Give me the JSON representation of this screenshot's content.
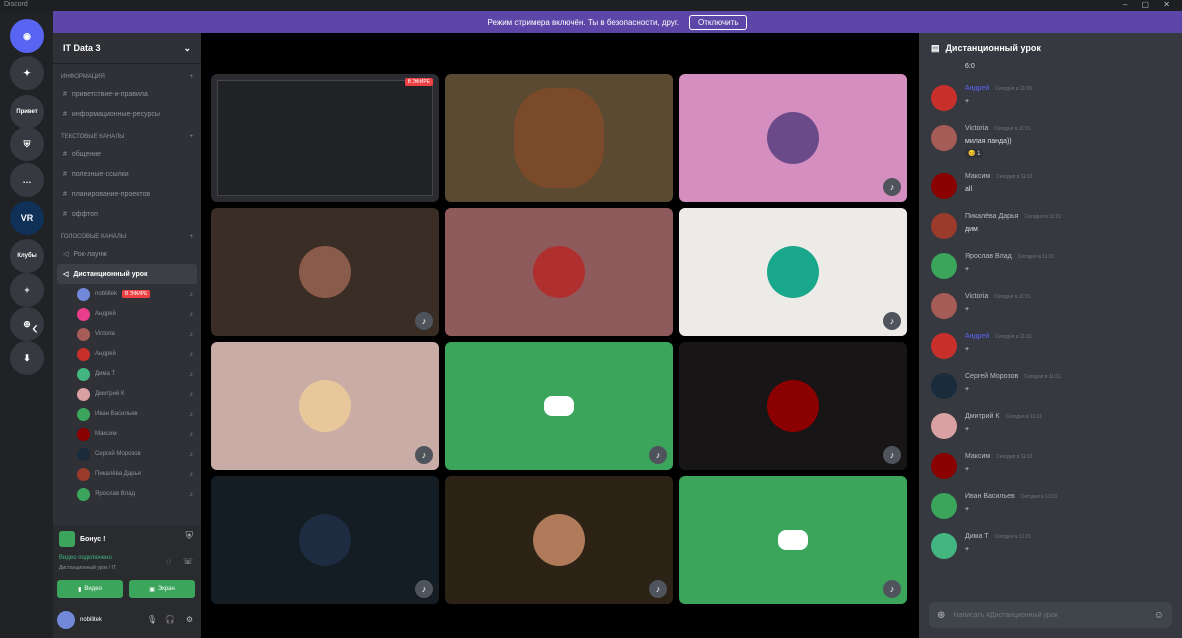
{
  "window": {
    "title": "Discord",
    "controls": "– ▢ ✕"
  },
  "notice": {
    "text": "Режим стримера включён. Ты в безопасности, друг.",
    "button": "Отключить"
  },
  "servers": [
    {
      "label": "Discord",
      "glyph": "◉",
      "color": "#5865f2"
    },
    {
      "label": "Ксюша",
      "glyph": "✦",
      "color": "#36393f"
    },
    {
      "label": "Привет",
      "glyph": "Привет",
      "color": "#36393f"
    },
    {
      "label": "World of Tanks",
      "glyph": "⛨",
      "color": "#36393f"
    },
    {
      "label": "Мафия",
      "glyph": "…",
      "color": "#36393f"
    },
    {
      "label": "VR Club",
      "glyph": "VR",
      "color": "#0f3057"
    },
    {
      "label": "Клубы",
      "glyph": "Клубы",
      "color": "#36393f"
    },
    {
      "label": "Add server",
      "glyph": "+",
      "color": "#36393f"
    },
    {
      "label": "Explore",
      "glyph": "⊕",
      "color": "#36393f"
    },
    {
      "label": "Download",
      "glyph": "⬇",
      "color": "#36393f"
    }
  ],
  "guild": {
    "name": "IT Data 3"
  },
  "categories": [
    {
      "name": "информация",
      "channels": [
        "приветствие-и-правила",
        "информационные-ресурсы"
      ]
    },
    {
      "name": "текстовые каналы",
      "channels": [
        "общение",
        "полезные-ссылки",
        "планирование-проектов",
        "оффтоп"
      ]
    },
    {
      "name": "голосовые каналы",
      "channels": [
        "Рок-лаунж",
        "Дистанционный урок"
      ]
    }
  ],
  "voice_users": [
    {
      "name": "nobilitek",
      "color": "#7289da",
      "live": true,
      "live_label": "В ЭФИРЕ"
    },
    {
      "name": "Андрей",
      "color": "#e83e8c"
    },
    {
      "name": "Victoria",
      "color": "#a65d57"
    },
    {
      "name": "Андрей",
      "color": "#c9302c"
    },
    {
      "name": "Дима Т",
      "color": "#43b581"
    },
    {
      "name": "Дмитрий К",
      "color": "#d9a1a1"
    },
    {
      "name": "Иван Васильев",
      "color": "#3ba55c"
    },
    {
      "name": "Максим",
      "color": "#8b0000"
    },
    {
      "name": "Сергей Морозов",
      "color": "#1a2b3c"
    },
    {
      "name": "Пикалёва Дарья",
      "color": "#9b3b2c"
    },
    {
      "name": "Ярослав Влад",
      "color": "#3ba55c"
    }
  ],
  "user_panel": {
    "server_label": "Бонус !",
    "voice_status": "Видео подключено",
    "voice_channel": "Дистанционный урок / IT",
    "video_button": "Видео",
    "screen_button": "Экран",
    "username": "nobilitek"
  },
  "tiles": [
    {
      "bg": "#2a2c31",
      "avatar": "",
      "mic": false
    },
    {
      "bg": "#5a4a32",
      "avatar": "#7a4a2a",
      "mic": false
    },
    {
      "bg": "#d48fc0",
      "avatar": "#6b4a8a",
      "mic": true
    },
    {
      "bg": "#3a2d25",
      "avatar": "#8a5a4a",
      "mic": true
    },
    {
      "bg": "#8e5a5c",
      "avatar": "#b03030",
      "mic": false
    },
    {
      "bg": "#ecebe7",
      "avatar": "#1aa88c",
      "mic": true
    },
    {
      "bg": "#c9aca6",
      "avatar": "#e8c89a",
      "mic": true
    },
    {
      "bg": "#3ba55c",
      "avatar": "",
      "mic": true,
      "discord": true
    },
    {
      "bg": "#171516",
      "avatar": "#8b0000",
      "mic": true
    },
    {
      "bg": "#141d24",
      "avatar": "#1d2c40",
      "mic": true
    },
    {
      "bg": "#2c2216",
      "avatar": "#b07a5a",
      "mic": true
    },
    {
      "bg": "#3ba55c",
      "avatar": "",
      "mic": true,
      "discord": true
    }
  ],
  "chat": {
    "title": "Дистанционный урок",
    "first_line": "6:0",
    "messages": [
      {
        "name": "Андрей",
        "name_color": "#5865f2",
        "time": "Сегодня в 11:00",
        "text": "+",
        "avatar": "#c9302c"
      },
      {
        "name": "Victoria",
        "name_color": "#b9bbbe",
        "time": "Сегодня в 11:01",
        "text": "милая панда))",
        "avatar": "#a65d57",
        "reaction": "😊 1"
      },
      {
        "name": "Максим",
        "name_color": "#b9bbbe",
        "time": "Сегодня в 11:01",
        "text": "all",
        "avatar": "#8b0000"
      },
      {
        "name": "Пикалёва Дарья",
        "name_color": "#b9bbbe",
        "time": "Сегодня в 11:01",
        "text": "дим",
        "avatar": "#9b3b2c"
      },
      {
        "name": "Ярослав Влад",
        "name_color": "#b9bbbe",
        "time": "Сегодня в 11:01",
        "text": "+",
        "avatar": "#3ba55c"
      },
      {
        "name": "Victoria",
        "name_color": "#b9bbbe",
        "time": "Сегодня в 11:01",
        "text": "+",
        "avatar": "#a65d57"
      },
      {
        "name": "Андрей",
        "name_color": "#5865f2",
        "time": "Сегодня в 11:01",
        "text": "+",
        "avatar": "#c9302c"
      },
      {
        "name": "Сергей Морозов",
        "name_color": "#b9bbbe",
        "time": "Сегодня в 11:01",
        "text": "+",
        "avatar": "#1a2b3c"
      },
      {
        "name": "Дмитрий К",
        "name_color": "#b9bbbe",
        "time": "Сегодня в 11:01",
        "text": "+",
        "avatar": "#d9a1a1"
      },
      {
        "name": "Максим",
        "name_color": "#b9bbbe",
        "time": "Сегодня в 11:01",
        "text": "+",
        "avatar": "#8b0000"
      },
      {
        "name": "Иван Васильев",
        "name_color": "#b9bbbe",
        "time": "Сегодня в 11:01",
        "text": "+",
        "avatar": "#3ba55c"
      },
      {
        "name": "Дима Т",
        "name_color": "#b9bbbe",
        "time": "Сегодня в 11:01",
        "text": "+",
        "avatar": "#43b581"
      }
    ],
    "input_placeholder": "Написать #Дистанционный урок"
  }
}
